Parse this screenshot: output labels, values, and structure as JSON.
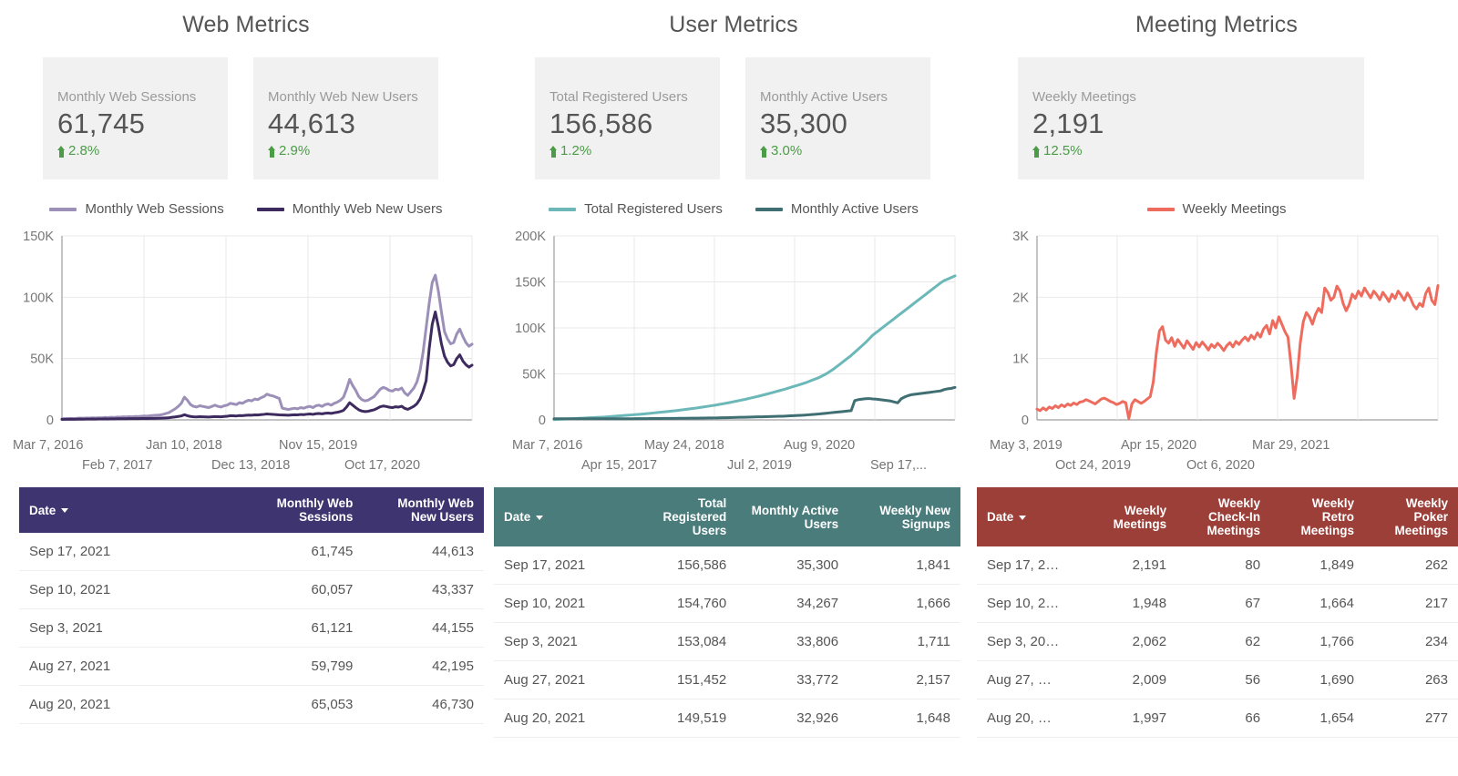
{
  "panels": [
    {
      "title": "Web Metrics",
      "cards": [
        {
          "label": "Monthly Web Sessions",
          "value": "61,745",
          "delta": "2.8%"
        },
        {
          "label": "Monthly Web New Users",
          "value": "44,613",
          "delta": "2.9%"
        }
      ],
      "legend": [
        {
          "label": "Monthly Web Sessions",
          "color": "#9c90b8"
        },
        {
          "label": "Monthly Web New Users",
          "color": "#3d2a5e"
        }
      ],
      "yticks": [
        "150K",
        "100K",
        "50K",
        "0"
      ],
      "xticks_top": [
        "Mar 7, 2016",
        "Jan 10, 2018",
        "Nov 15, 2019"
      ],
      "xticks_bottom": [
        "Feb 7, 2017",
        "Dec 13, 2018",
        "Oct 17, 2020"
      ],
      "table": {
        "header_color": "#3d3470",
        "columns": [
          "Date",
          "Monthly Web Sessions",
          "Monthly Web New Users"
        ],
        "rows": [
          [
            "Sep 17, 2021",
            "61,745",
            "44,613"
          ],
          [
            "Sep 10, 2021",
            "60,057",
            "43,337"
          ],
          [
            "Sep 3, 2021",
            "61,121",
            "44,155"
          ],
          [
            "Aug 27, 2021",
            "59,799",
            "42,195"
          ],
          [
            "Aug 20, 2021",
            "65,053",
            "46,730"
          ]
        ]
      }
    },
    {
      "title": "User Metrics",
      "cards": [
        {
          "label": "Total Registered Users",
          "value": "156,586",
          "delta": "1.2%"
        },
        {
          "label": "Monthly Active Users",
          "value": "35,300",
          "delta": "3.0%"
        }
      ],
      "legend": [
        {
          "label": "Total Registered Users",
          "color": "#6cb8b8"
        },
        {
          "label": "Monthly Active Users",
          "color": "#3f6f73"
        }
      ],
      "yticks": [
        "200K",
        "150K",
        "100K",
        "50K",
        "0"
      ],
      "xticks_top": [
        "Mar 7, 2016",
        "May 24, 2018",
        "Aug 9, 2020"
      ],
      "xticks_bottom": [
        "Apr 15, 2017",
        "Jul 2, 2019",
        "Sep 17,..."
      ],
      "table": {
        "header_color": "#4a7c7c",
        "columns": [
          "Date",
          "Total Registered Users",
          "Monthly Active Users",
          "Weekly New Signups"
        ],
        "rows": [
          [
            "Sep 17, 2021",
            "156,586",
            "35,300",
            "1,841"
          ],
          [
            "Sep 10, 2021",
            "154,760",
            "34,267",
            "1,666"
          ],
          [
            "Sep 3, 2021",
            "153,084",
            "33,806",
            "1,711"
          ],
          [
            "Aug 27, 2021",
            "151,452",
            "33,772",
            "2,157"
          ],
          [
            "Aug 20, 2021",
            "149,519",
            "32,926",
            "1,648"
          ]
        ]
      }
    },
    {
      "title": "Meeting Metrics",
      "cards": [
        {
          "label": "Weekly Meetings",
          "value": "2,191",
          "delta": "12.5%"
        }
      ],
      "legend": [
        {
          "label": "Weekly Meetings",
          "color": "#ee6c5e"
        }
      ],
      "yticks": [
        "3K",
        "2K",
        "1K",
        "0"
      ],
      "xticks_top": [
        "May 3, 2019",
        "Apr 15, 2020",
        "Mar 29, 2021"
      ],
      "xticks_bottom": [
        "Oct 24, 2019",
        "Oct 6, 2020"
      ],
      "table": {
        "header_color": "#9c3f38",
        "columns": [
          "Date",
          "Weekly Meetings",
          "Weekly Check-In Meetings",
          "Weekly Retro Meetings",
          "Weekly Poker Meetings"
        ],
        "rows": [
          [
            "Sep 17, 2…",
            "2,191",
            "80",
            "1,849",
            "262"
          ],
          [
            "Sep 10, 2…",
            "1,948",
            "67",
            "1,664",
            "217"
          ],
          [
            "Sep 3, 20…",
            "2,062",
            "62",
            "1,766",
            "234"
          ],
          [
            "Aug 27, …",
            "2,009",
            "56",
            "1,690",
            "263"
          ],
          [
            "Aug 20, …",
            "1,997",
            "66",
            "1,654",
            "277"
          ]
        ]
      }
    }
  ],
  "chart_data": [
    {
      "type": "line",
      "title": "Web Metrics",
      "xlabel": "",
      "ylabel": "",
      "ylim": [
        0,
        150000
      ],
      "yticks": [
        0,
        50000,
        100000,
        150000
      ],
      "ytick_labels": [
        "0",
        "50K",
        "100K",
        "150K"
      ],
      "grid": true,
      "legend_position": "top-center",
      "x_start": "Mar 7, 2016",
      "x_end": "Sep 17, 2021",
      "x_tick_labels": [
        "Mar 7, 2016",
        "Feb 7, 2017",
        "Jan 10, 2018",
        "Dec 13, 2018",
        "Nov 15, 2019",
        "Oct 17, 2020"
      ],
      "series": [
        {
          "name": "Monthly Web Sessions",
          "color": "#9c90b8",
          "values": [
            900,
            1000,
            1100,
            1200,
            1000,
            1300,
            1500,
            1400,
            1600,
            1500,
            1700,
            1600,
            1800,
            1700,
            2000,
            1900,
            2100,
            2000,
            2300,
            2200,
            2500,
            2400,
            2600,
            2500,
            2800,
            2700,
            3000,
            3200,
            3100,
            3400,
            3600,
            3800,
            4000,
            4500,
            5200,
            6000,
            7500,
            9000,
            11000,
            13500,
            18500,
            16000,
            12500,
            11000,
            10500,
            11500,
            11000,
            10500,
            10000,
            11000,
            12000,
            11000,
            10500,
            11500,
            12000,
            13500,
            13000,
            12500,
            14000,
            13500,
            15000,
            16000,
            15500,
            17000,
            16500,
            18000,
            19000,
            21000,
            20000,
            19500,
            18500,
            17500,
            9500,
            9000,
            8500,
            9000,
            9500,
            9000,
            10000,
            9500,
            10500,
            11000,
            10000,
            11500,
            12000,
            11000,
            12500,
            13000,
            12000,
            13500,
            14500,
            16000,
            18500,
            25000,
            33000,
            28000,
            24000,
            19000,
            16500,
            15500,
            16000,
            17500,
            19000,
            22000,
            25000,
            26500,
            25500,
            24000,
            23500,
            25000,
            24500,
            26000,
            22000,
            20000,
            23000,
            26000,
            31000,
            40000,
            55000,
            75000,
            95000,
            112000,
            118000,
            105000,
            88000,
            72000,
            66000,
            62000,
            63000,
            70000,
            74000,
            68000,
            63000,
            60000,
            61745
          ]
        },
        {
          "name": "Monthly Web New Users",
          "color": "#3d2a5e",
          "values": [
            400,
            450,
            500,
            520,
            480,
            560,
            620,
            600,
            680,
            650,
            700,
            680,
            740,
            720,
            800,
            780,
            850,
            820,
            900,
            880,
            950,
            930,
            1000,
            980,
            1050,
            1020,
            1100,
            1150,
            1120,
            1200,
            1250,
            1300,
            1350,
            1450,
            1600,
            1800,
            2100,
            2400,
            2800,
            3200,
            4200,
            3400,
            2800,
            2500,
            2400,
            2600,
            2500,
            2400,
            2300,
            2500,
            2700,
            2600,
            2500,
            2800,
            3000,
            3400,
            3300,
            3200,
            3500,
            3400,
            3700,
            3900,
            3800,
            4100,
            4000,
            4300,
            4500,
            4800,
            4600,
            4500,
            4300,
            4100,
            4000,
            3900,
            3800,
            4000,
            4200,
            4100,
            4400,
            4300,
            4600,
            4800,
            4500,
            5000,
            5200,
            4900,
            5400,
            5600,
            5300,
            5800,
            6200,
            6800,
            7800,
            10500,
            14000,
            12000,
            10000,
            8200,
            7200,
            6800,
            7000,
            7600,
            8200,
            9400,
            10700,
            11300,
            10900,
            10300,
            10000,
            10700,
            10400,
            11100,
            9400,
            8600,
            9800,
            11100,
            13200,
            17000,
            23500,
            32000,
            58000,
            78000,
            88000,
            76000,
            62000,
            52000,
            47000,
            44000,
            45000,
            50000,
            53000,
            48000,
            45000,
            43000,
            44613
          ]
        }
      ]
    },
    {
      "type": "line",
      "title": "User Metrics",
      "xlabel": "",
      "ylabel": "",
      "ylim": [
        0,
        200000
      ],
      "yticks": [
        0,
        50000,
        100000,
        150000,
        200000
      ],
      "ytick_labels": [
        "0",
        "50K",
        "100K",
        "150K",
        "200K"
      ],
      "grid": true,
      "legend_position": "top-center",
      "x_start": "Mar 7, 2016",
      "x_end": "Sep 17, 2021",
      "x_tick_labels": [
        "Mar 7, 2016",
        "Apr 15, 2017",
        "May 24, 2018",
        "Jul 2, 2019",
        "Aug 9, 2020",
        "Sep 17,..."
      ],
      "series": [
        {
          "name": "Total Registered Users",
          "color": "#6cb8b8",
          "values": [
            300,
            500,
            700,
            900,
            1100,
            1300,
            1500,
            1700,
            1900,
            2100,
            2300,
            2500,
            2700,
            2900,
            3100,
            3400,
            3700,
            4000,
            4300,
            4600,
            4900,
            5200,
            5500,
            5800,
            6100,
            6400,
            6800,
            7200,
            7600,
            8000,
            8400,
            8800,
            9200,
            9600,
            10000,
            10500,
            11000,
            11500,
            12000,
            12500,
            13000,
            13600,
            14200,
            14800,
            15400,
            16000,
            16700,
            17400,
            18100,
            18800,
            19600,
            20400,
            21200,
            22000,
            22900,
            23800,
            24700,
            25600,
            26600,
            27600,
            28600,
            29600,
            30700,
            31800,
            32900,
            34000,
            35200,
            36400,
            37600,
            38800,
            40000,
            41500,
            43000,
            44500,
            46000,
            48000,
            50000,
            52500,
            55000,
            58000,
            61000,
            64000,
            67000,
            70000,
            73500,
            77000,
            80500,
            84000,
            88000,
            92000,
            95000,
            98000,
            101000,
            104000,
            107000,
            110000,
            113000,
            116000,
            119000,
            122000,
            125000,
            128000,
            131000,
            134000,
            137000,
            140000,
            143000,
            146000,
            149000,
            151500,
            153100,
            154800,
            156586
          ]
        },
        {
          "name": "Monthly Active Users",
          "color": "#3f6f73",
          "values": [
            1200,
            1200,
            1200,
            1200,
            1200,
            1200,
            1200,
            1200,
            1200,
            1200,
            1200,
            1200,
            1200,
            1200,
            1200,
            1200,
            1200,
            1250,
            1250,
            1250,
            1300,
            1300,
            1300,
            1350,
            1350,
            1400,
            1400,
            1450,
            1450,
            1500,
            1500,
            1550,
            1600,
            1600,
            1650,
            1700,
            1700,
            1750,
            1800,
            1850,
            1900,
            1950,
            2000,
            2050,
            2100,
            2150,
            2200,
            2300,
            2400,
            2500,
            2600,
            2700,
            2800,
            2900,
            3000,
            3100,
            3200,
            3300,
            3400,
            3500,
            3600,
            3700,
            3800,
            3900,
            4000,
            4200,
            4400,
            4600,
            4800,
            5000,
            5200,
            5500,
            5800,
            6100,
            6400,
            6800,
            7200,
            7600,
            8000,
            8400,
            8800,
            9200,
            9600,
            10000,
            21000,
            22000,
            22500,
            23000,
            23200,
            22800,
            22500,
            22000,
            21500,
            21000,
            20500,
            19500,
            18500,
            23000,
            25000,
            26500,
            27500,
            28000,
            28500,
            29000,
            29500,
            30000,
            30500,
            31000,
            31500,
            33000,
            33800,
            34300,
            35300
          ]
        }
      ]
    },
    {
      "type": "line",
      "title": "Meeting Metrics",
      "xlabel": "",
      "ylabel": "",
      "ylim": [
        0,
        3000
      ],
      "yticks": [
        0,
        1000,
        2000,
        3000
      ],
      "ytick_labels": [
        "0",
        "1K",
        "2K",
        "3K"
      ],
      "grid": true,
      "legend_position": "top-center",
      "x_start": "May 3, 2019",
      "x_end": "Sep 17, 2021",
      "x_tick_labels": [
        "May 3, 2019",
        "Oct 24, 2019",
        "Apr 15, 2020",
        "Oct 6, 2020",
        "Mar 29, 2021"
      ],
      "series": [
        {
          "name": "Weekly Meetings",
          "color": "#ee6c5e",
          "values": [
            175,
            150,
            195,
            160,
            210,
            185,
            230,
            200,
            245,
            215,
            260,
            235,
            275,
            250,
            290,
            300,
            330,
            310,
            285,
            260,
            300,
            340,
            355,
            330,
            300,
            280,
            250,
            270,
            300,
            280,
            20,
            260,
            330,
            300,
            270,
            300,
            340,
            380,
            620,
            1100,
            1450,
            1520,
            1300,
            1250,
            1340,
            1200,
            1310,
            1240,
            1170,
            1290,
            1220,
            1150,
            1260,
            1190,
            1270,
            1210,
            1140,
            1230,
            1180,
            1250,
            1200,
            1130,
            1210,
            1260,
            1190,
            1280,
            1230,
            1300,
            1350,
            1290,
            1380,
            1320,
            1420,
            1350,
            1480,
            1540,
            1400,
            1620,
            1500,
            1680,
            1560,
            1440,
            1350,
            900,
            350,
            700,
            1250,
            1600,
            1750,
            1680,
            1560,
            1720,
            1820,
            1750,
            2150,
            2080,
            1950,
            2000,
            2180,
            2100,
            1900,
            1780,
            1880,
            2050,
            1980,
            2100,
            2020,
            2150,
            2070,
            1990,
            2100,
            2040,
            1960,
            2080,
            2010,
            1930,
            2050,
            1980,
            2100,
            2030,
            1950,
            2070,
            1990,
            1870,
            1810,
            1900,
            1850,
            2060,
            2150,
            1950,
            1880,
            2191
          ]
        }
      ]
    }
  ]
}
